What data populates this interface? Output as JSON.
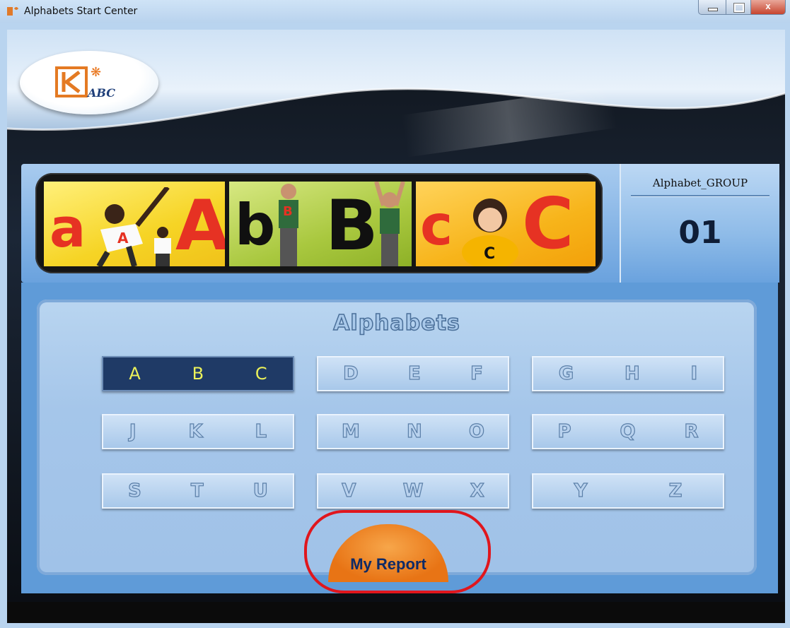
{
  "window": {
    "title": "Alphabets Start Center",
    "controls": {
      "minimize": "",
      "maximize": "",
      "close": "x"
    }
  },
  "logo": {
    "text": "ABC"
  },
  "banner": {
    "panels": [
      {
        "small": "a",
        "big": "A",
        "shirt": "A"
      },
      {
        "small": "b",
        "big": "B",
        "shirt": "B"
      },
      {
        "small": "c",
        "big": "C",
        "shirt": "C"
      }
    ]
  },
  "group": {
    "label": "Alphabet_GROUP",
    "number": "01"
  },
  "main": {
    "title": "Alphabets",
    "groups": [
      {
        "letters": [
          "A",
          "B",
          "C"
        ],
        "selected": true
      },
      {
        "letters": [
          "D",
          "E",
          "F"
        ],
        "selected": false
      },
      {
        "letters": [
          "G",
          "H",
          "I"
        ],
        "selected": false
      },
      {
        "letters": [
          "J",
          "K",
          "L"
        ],
        "selected": false
      },
      {
        "letters": [
          "M",
          "N",
          "O"
        ],
        "selected": false
      },
      {
        "letters": [
          "P",
          "Q",
          "R"
        ],
        "selected": false
      },
      {
        "letters": [
          "S",
          "T",
          "U"
        ],
        "selected": false
      },
      {
        "letters": [
          "V",
          "W",
          "X"
        ],
        "selected": false
      },
      {
        "letters": [
          "Y",
          "Z"
        ],
        "selected": false
      }
    ],
    "report_label": "My Report"
  },
  "colors": {
    "selected_bg": "#1f3a66",
    "selected_text": "#ecf25a",
    "report": "#e87415",
    "highlight": "#e0161d"
  }
}
